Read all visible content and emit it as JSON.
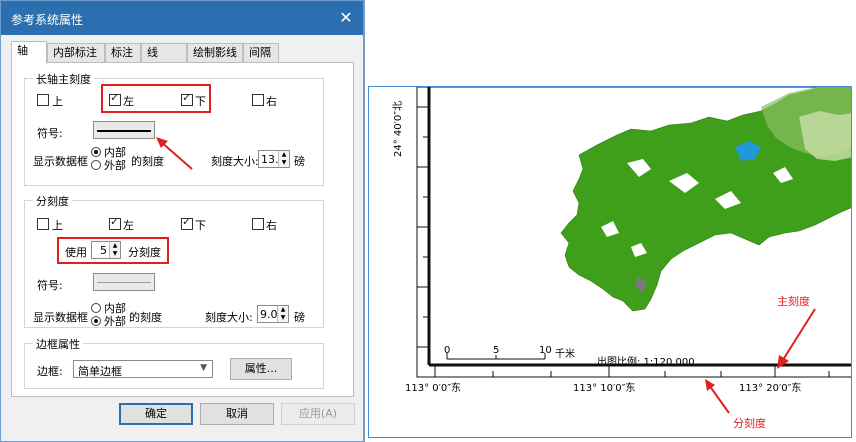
{
  "dialog": {
    "title": "参考系统属性",
    "tabs": [
      {
        "label": "轴"
      },
      {
        "label": "内部标注"
      },
      {
        "label": "标注"
      },
      {
        "label": "线"
      },
      {
        "label": "绘制影线"
      },
      {
        "label": "间隔"
      }
    ],
    "major": {
      "title": "长轴主刻度",
      "top": {
        "label": "上",
        "checked": false
      },
      "left": {
        "label": "左",
        "checked": true
      },
      "bottom": {
        "label": "下",
        "checked": true
      },
      "right": {
        "label": "右",
        "checked": false
      },
      "symbol_label": "符号:",
      "display_label": "显示数据框",
      "inner": "内部",
      "outer": "外部",
      "ticks_label": "的刻度",
      "size_label": "刻度大小:",
      "size_value": "13.",
      "unit": "磅"
    },
    "minor": {
      "title": "分刻度",
      "top": {
        "label": "上",
        "checked": false
      },
      "left": {
        "label": "左",
        "checked": true
      },
      "bottom": {
        "label": "下",
        "checked": true
      },
      "right": {
        "label": "右",
        "checked": false
      },
      "use_label": "使用",
      "count_value": "5",
      "minor_label": "分刻度",
      "symbol_label": "符号:",
      "display_label": "显示数据框",
      "inner": "内部",
      "outer": "外部",
      "ticks_label": "的刻度",
      "size_label": "刻度大小:",
      "size_value": "9.0",
      "unit": "磅"
    },
    "border": {
      "title": "边框属性",
      "label": "边框:",
      "value": "简单边框",
      "props_button": "属性..."
    },
    "buttons": {
      "ok": "确定",
      "cancel": "取消",
      "apply": "应用(A)"
    }
  },
  "map": {
    "lat_label": "24° 40′0″北",
    "lon_labels": [
      "113° 0′0″东",
      "113° 10′0″东",
      "113° 20′0″东"
    ],
    "scale_numbers": [
      "0",
      "5",
      "10"
    ],
    "scale_unit": "千米",
    "scale_text": "出图比例: 1:120,000",
    "major_tick_label": "主刻度",
    "minor_tick_label": "分刻度",
    "colors": {
      "land": "#3f9e1a",
      "light_land": "#8cc163",
      "water": "#1f9ad6",
      "annotation": "#e02020"
    }
  }
}
